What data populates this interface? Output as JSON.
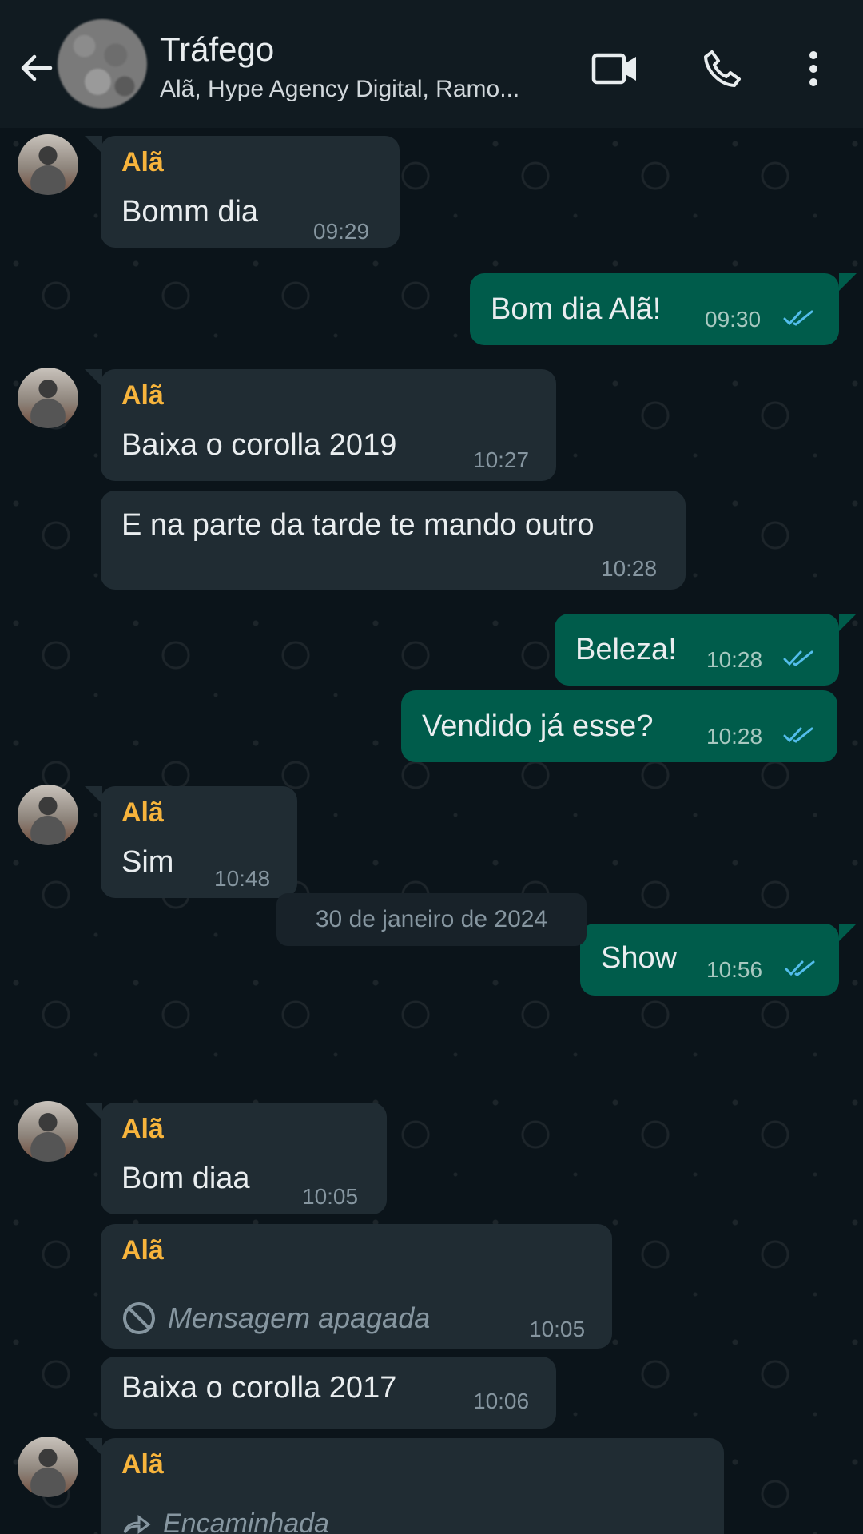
{
  "header": {
    "title": "Tráfego",
    "subtitle": "Alã, Hype Agency Digital, Ramo...",
    "icons": [
      "back-arrow-icon",
      "video-call-icon",
      "phone-icon",
      "more-options-icon"
    ]
  },
  "messages": [
    {
      "sender": "Alã",
      "text": "Bomm dia",
      "time": "09:29"
    },
    {
      "text": "Bom dia Alã!",
      "time": "09:30"
    },
    {
      "sender": "Alã",
      "text": "Baixa o corolla 2019",
      "time": "10:27"
    },
    {
      "text": "E na parte da tarde te mando outro",
      "time": "10:28"
    },
    {
      "text": "Beleza!",
      "time": "10:28"
    },
    {
      "text": "Vendido já esse?",
      "time": "10:28"
    },
    {
      "sender": "Alã",
      "text": "Sim",
      "time": "10:48"
    },
    {
      "text": "Show",
      "time": "10:56"
    },
    {
      "sender": "Alã",
      "text": "Bom diaa",
      "time": "10:05"
    },
    {
      "sender": "Alã",
      "text": "Mensagem apagada",
      "time": "10:05"
    },
    {
      "text": "Baixa o corolla 2017",
      "time": "10:06"
    },
    {
      "sender": "Alã",
      "text": "Encaminhada"
    }
  ],
  "date_separator": "30 de janeiro de 2024",
  "colors": {
    "incoming_bubble": "#202c33",
    "outgoing_bubble": "#005c4b",
    "sender_name": "#f7b43c",
    "read_ticks": "#53bdeb",
    "background": "#0b141a"
  }
}
